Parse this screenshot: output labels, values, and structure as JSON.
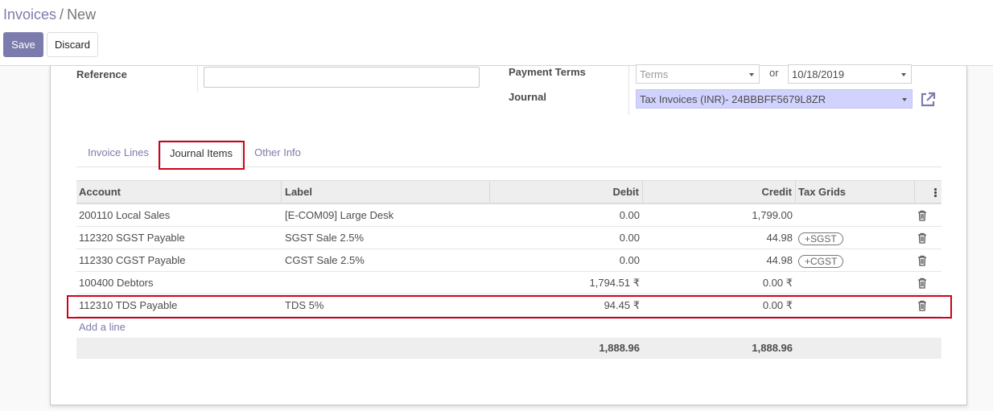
{
  "breadcrumb": {
    "parent": "Invoices",
    "separator": "/",
    "current": "New"
  },
  "actions": {
    "save_label": "Save",
    "discard_label": "Discard"
  },
  "form": {
    "reference_label": "Reference",
    "reference_value": "",
    "payment_terms_label": "Payment Terms",
    "payment_terms_placeholder": "Terms",
    "or_label": "or",
    "due_date": "10/18/2019",
    "journal_label": "Journal",
    "journal_value": "Tax Invoices (INR)- 24BBBFF5679L8ZR"
  },
  "tabs": [
    {
      "label": "Invoice Lines"
    },
    {
      "label": "Journal Items"
    },
    {
      "label": "Other Info"
    }
  ],
  "active_tab": "Journal Items",
  "grid": {
    "headers": {
      "account": "Account",
      "label": "Label",
      "debit": "Debit",
      "credit": "Credit",
      "tax_grids": "Tax Grids"
    },
    "rows": [
      {
        "account": "200110 Local Sales",
        "label": "[E-COM09] Large Desk",
        "debit": "0.00",
        "credit": "1,799.00",
        "tax_grid": ""
      },
      {
        "account": "112320 SGST Payable",
        "label": "SGST Sale 2.5%",
        "debit": "0.00",
        "credit": "44.98",
        "tax_grid": "+SGST"
      },
      {
        "account": "112330 CGST Payable",
        "label": "CGST Sale 2.5%",
        "debit": "0.00",
        "credit": "44.98",
        "tax_grid": "+CGST"
      },
      {
        "account": "100400 Debtors",
        "label": "",
        "debit": "1,794.51 ₹",
        "credit": "0.00 ₹",
        "tax_grid": ""
      },
      {
        "account": "112310 TDS Payable",
        "label": "TDS 5%",
        "debit": "94.45 ₹",
        "credit": "0.00 ₹",
        "tax_grid": ""
      }
    ],
    "add_line_label": "Add a line",
    "totals": {
      "debit": "1,888.96",
      "credit": "1,888.96"
    }
  },
  "colors": {
    "brand": "#7c7bad",
    "highlight": "#d0021b",
    "required_field": "#d2d2ff"
  },
  "icons": {
    "external_link": "external-link-icon",
    "delete": "trash-icon",
    "column_options": "kebab-icon"
  }
}
